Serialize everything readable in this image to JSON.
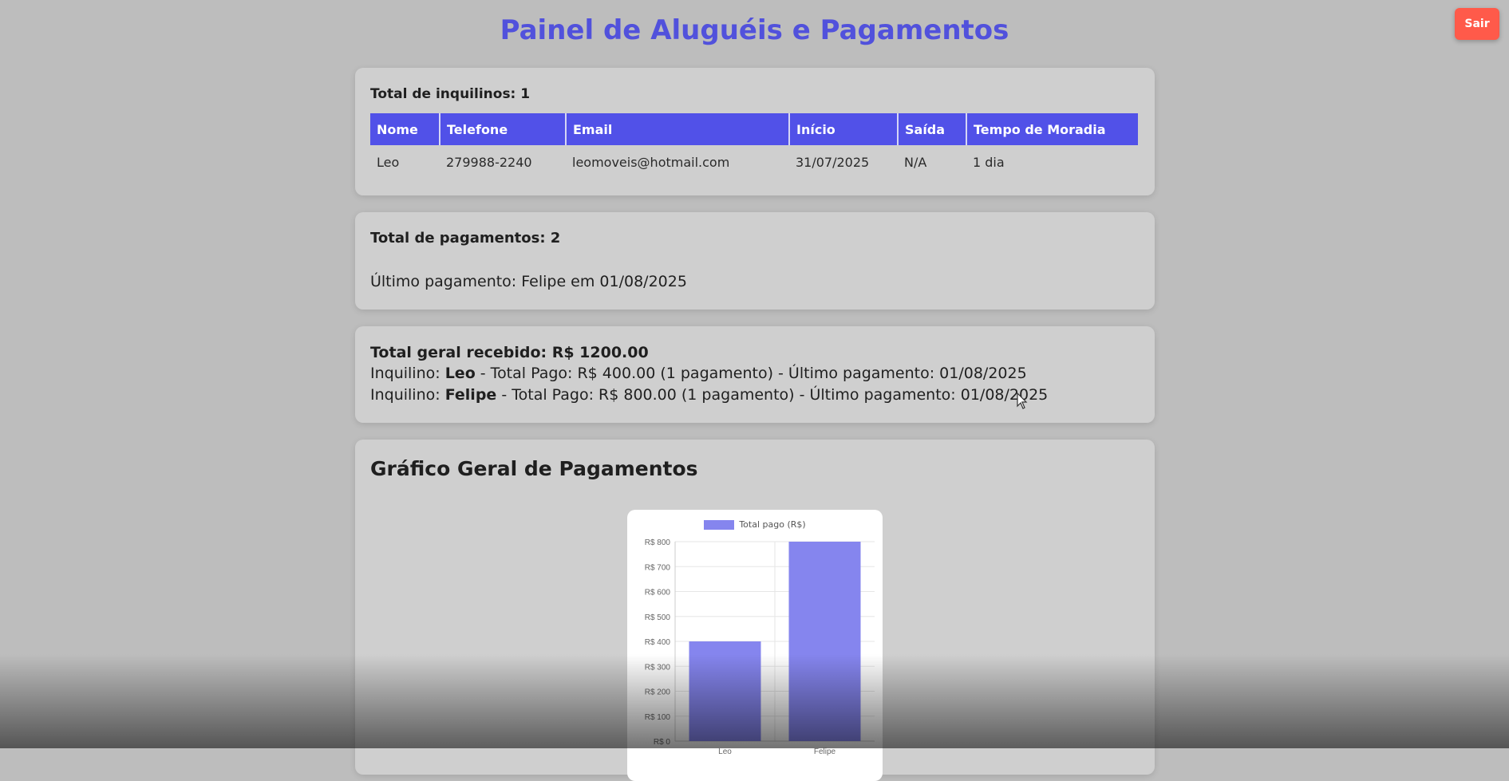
{
  "page": {
    "title": "Painel de Aluguéis e Pagamentos",
    "logout_label": "Sair"
  },
  "tenants": {
    "count_label": "Total de inquilinos: 1",
    "columns": [
      "Nome",
      "Telefone",
      "Email",
      "Início",
      "Saída",
      "Tempo de Moradia"
    ],
    "rows": [
      [
        "Leo",
        "279988-2240",
        "leomoveis@hotmail.com",
        "31/07/2025",
        "N/A",
        "1 dia"
      ]
    ]
  },
  "payments": {
    "total_label": "Total de pagamentos: 2",
    "last_label": "Último pagamento: Felipe em 01/08/2025"
  },
  "summary": {
    "total_label": "Total geral recebido: R$ 1200.00",
    "lines": [
      {
        "prefix": "Inquilino: ",
        "name": "Leo",
        "suffix": " - Total Pago: R$ 400.00 (1 pagamento) - Último pagamento: 01/08/2025"
      },
      {
        "prefix": "Inquilino: ",
        "name": "Felipe",
        "suffix": " - Total Pago: R$ 800.00 (1 pagamento) - Último pagamento: 01/08/2025"
      }
    ]
  },
  "chart_section": {
    "title": "Gráfico Geral de Pagamentos"
  },
  "chart_data": {
    "type": "bar",
    "categories": [
      "Leo",
      "Felipe"
    ],
    "series": [
      {
        "name": "Total pago (R$)",
        "values": [
          400,
          800
        ]
      }
    ],
    "ylim": [
      0,
      800
    ],
    "yticks": [
      "R$ 0",
      "R$ 100",
      "R$ 200",
      "R$ 300",
      "R$ 400",
      "R$ 500",
      "R$ 600",
      "R$ 700",
      "R$ 800"
    ],
    "grid": true,
    "legend_position": "top",
    "bar_color": "#8585ee"
  }
}
